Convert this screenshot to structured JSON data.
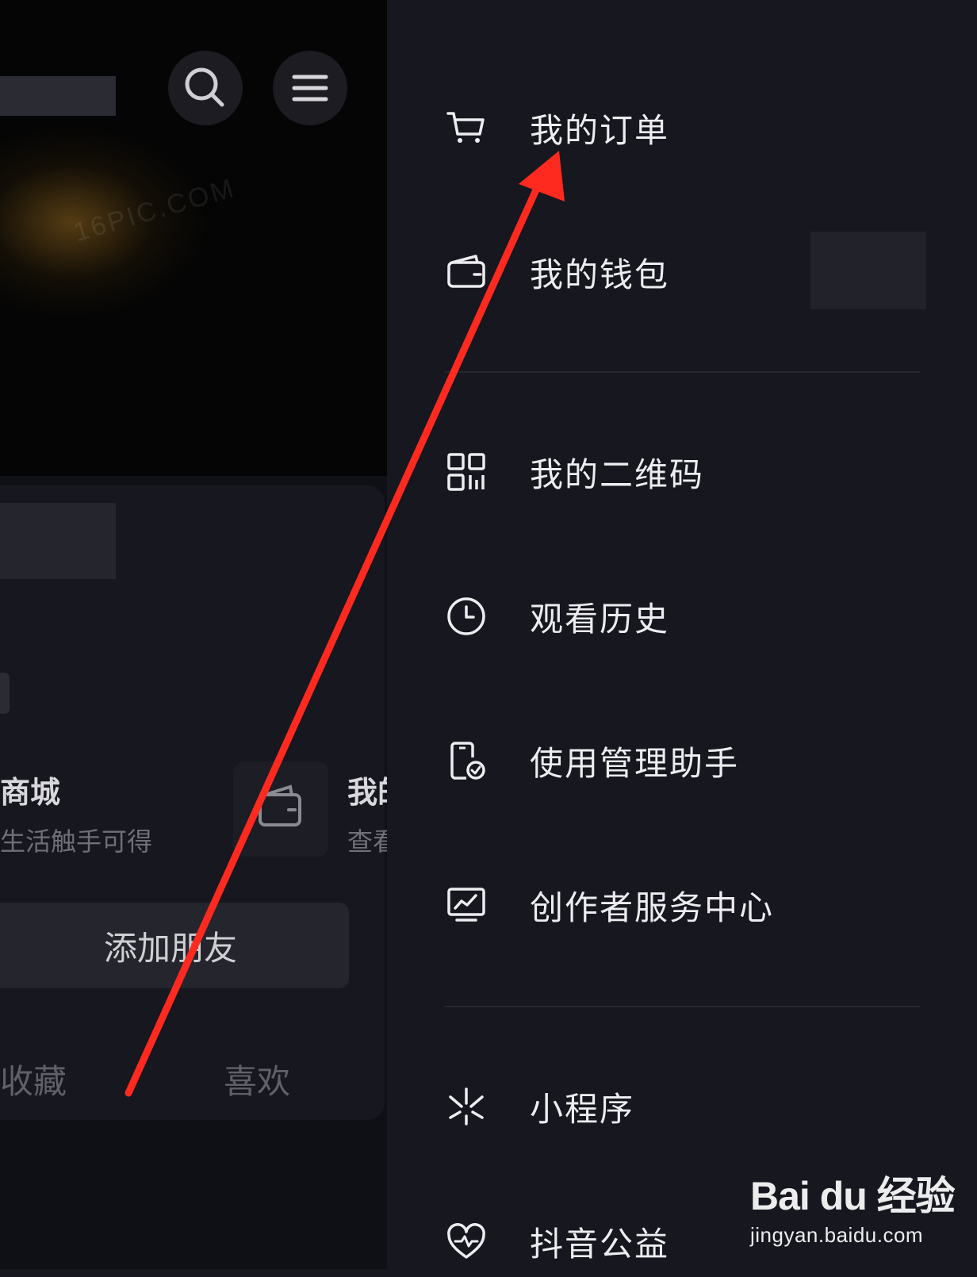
{
  "profile": {
    "mall_title": "商城",
    "mall_subtitle": "生活触手可得",
    "wallet_title": "我的",
    "wallet_subtitle": "查看",
    "add_friend_label": "添加朋友",
    "tabs": [
      "收藏",
      "喜欢"
    ],
    "cover_watermark": "16PIC.COM"
  },
  "drawer": {
    "items": [
      {
        "label": "我的订单",
        "icon": "cart-icon"
      },
      {
        "label": "我的钱包",
        "icon": "wallet-icon"
      },
      {
        "label": "我的二维码",
        "icon": "qr-code-icon"
      },
      {
        "label": "观看历史",
        "icon": "clock-icon"
      },
      {
        "label": "使用管理助手",
        "icon": "phone-check-icon"
      },
      {
        "label": "创作者服务中心",
        "icon": "chart-monitor-icon"
      },
      {
        "label": "小程序",
        "icon": "mini-program-icon"
      },
      {
        "label": "抖音公益",
        "icon": "heart-icon"
      }
    ]
  },
  "annotation": {
    "arrow_color": "#ff2a1f"
  },
  "watermark": {
    "logo": "Bai du 经验",
    "url": "jingyan.baidu.com"
  }
}
